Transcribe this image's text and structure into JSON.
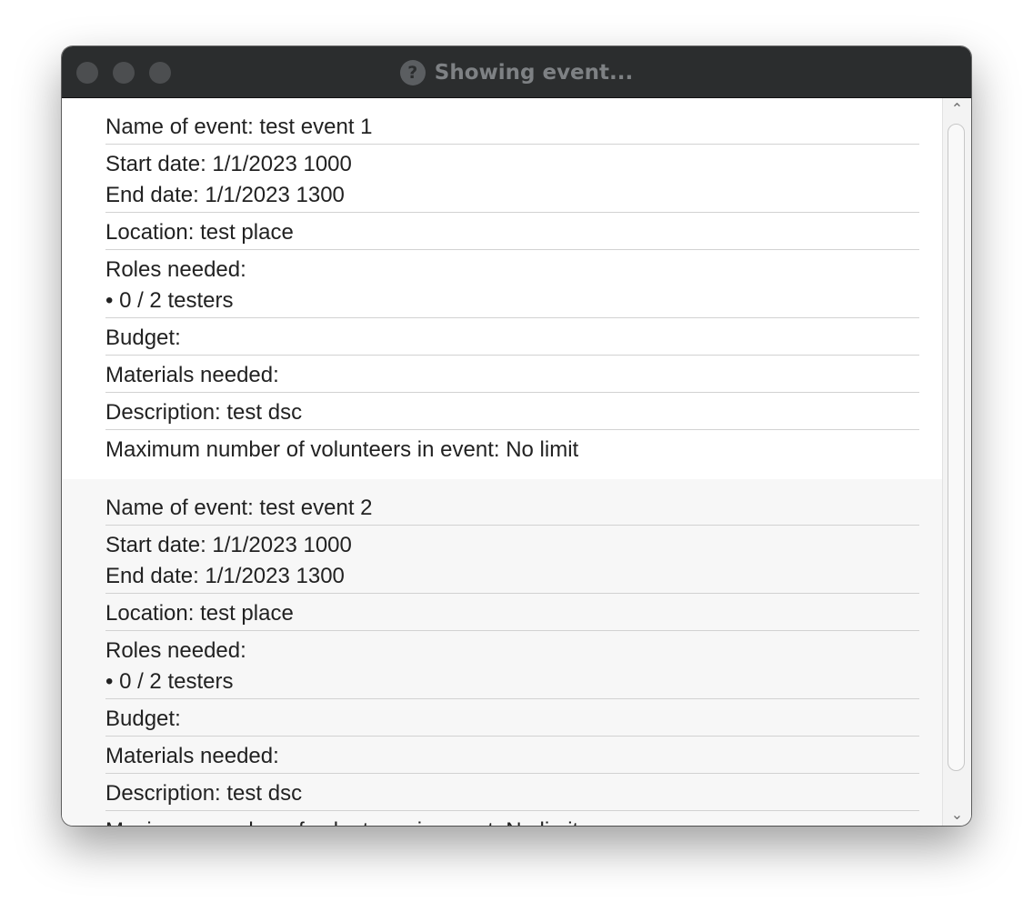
{
  "window": {
    "title": "Showing event...",
    "title_icon": "?"
  },
  "events": [
    {
      "name": "Name of event: test event 1",
      "start": "Start date: 1/1/2023 1000",
      "end": "End date: 1/1/2023 1300",
      "location": "Location: test place",
      "roles_label": "Roles needed:",
      "roles_item": "• 0 / 2 testers",
      "budget": "Budget:",
      "materials": "Materials needed:",
      "description": "Description: test dsc",
      "max_volunteers": "Maximum number of volunteers in event: No limit"
    },
    {
      "name": "Name of event: test event 2",
      "start": "Start date: 1/1/2023 1000",
      "end": "End date: 1/1/2023 1300",
      "location": "Location: test place",
      "roles_label": "Roles needed:",
      "roles_item": "• 0 / 2 testers",
      "budget": "Budget:",
      "materials": "Materials needed:",
      "description": "Description: test dsc",
      "max_volunteers": "Maximum number of volunteers in event: No limit"
    }
  ],
  "scrollbar": {
    "up_glyph": "⌃",
    "down_glyph": "⌄"
  }
}
